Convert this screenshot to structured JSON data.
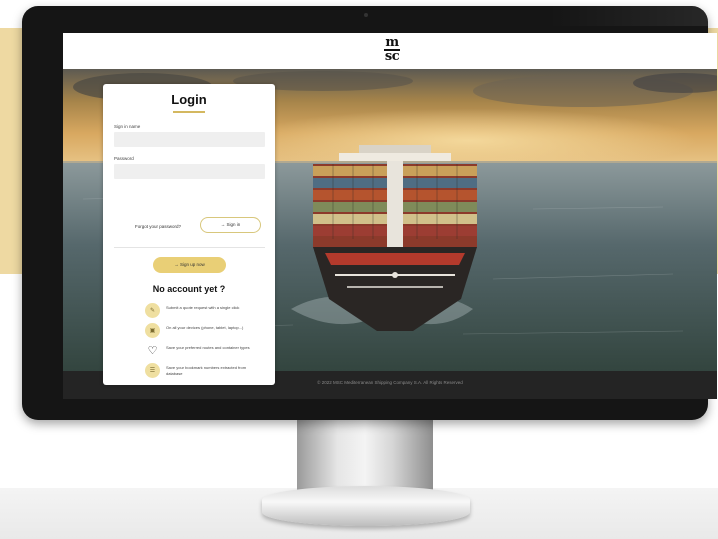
{
  "brand": {
    "logo_top": "m",
    "logo_bottom": "sc"
  },
  "login": {
    "title": "Login",
    "username_label": "Sign in name",
    "password_label": "Password",
    "forgot_label": "Forgot your password?",
    "signin_label": "→ Sign in",
    "signup_label": "→ Sign up now",
    "no_account": "No account yet ?"
  },
  "features": [
    {
      "icon": "quote-icon",
      "text": "Submit a quote request with a single click"
    },
    {
      "icon": "devices-icon",
      "text": "On all your devices (phone, tablet, laptop...)"
    },
    {
      "icon": "heart-icon",
      "text": "Save your preferred routes and container types"
    },
    {
      "icon": "document-icon",
      "text": "Save your bookmark numbers extracted from database"
    }
  ],
  "footer": {
    "text": "© 2022 MSC Mediterranean Shipping Company S.A. All Rights Reserved"
  },
  "colors": {
    "accent": "#e9cf76",
    "band": "#eed9a2",
    "footer": "#242424"
  }
}
